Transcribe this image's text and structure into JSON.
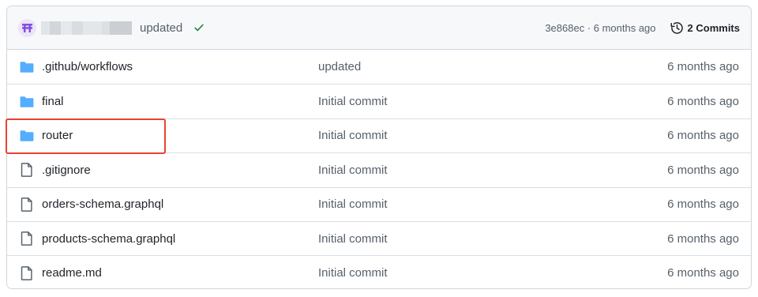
{
  "latest_commit": {
    "message": "updated",
    "sha_info": "3e868ec · 6 months ago",
    "commits_label": "2 Commits"
  },
  "files": [
    {
      "name": ".github/workflows",
      "type": "folder",
      "message": "updated",
      "age": "6 months ago"
    },
    {
      "name": "final",
      "type": "folder",
      "message": "Initial commit",
      "age": "6 months ago"
    },
    {
      "name": "router",
      "type": "folder",
      "message": "Initial commit",
      "age": "6 months ago"
    },
    {
      "name": ".gitignore",
      "type": "file",
      "message": "Initial commit",
      "age": "6 months ago"
    },
    {
      "name": "orders-schema.graphql",
      "type": "file",
      "message": "Initial commit",
      "age": "6 months ago"
    },
    {
      "name": "products-schema.graphql",
      "type": "file",
      "message": "Initial commit",
      "age": "6 months ago"
    },
    {
      "name": "readme.md",
      "type": "file",
      "message": "Initial commit",
      "age": "6 months ago"
    }
  ],
  "icons": {
    "folder": "folder-icon",
    "file": "file-icon",
    "check": "check-icon",
    "history": "history-icon",
    "avatar": "avatar"
  },
  "colors": {
    "folder": "#54aeff",
    "check": "#1a7f37",
    "highlight": "#e8432f",
    "avatar": "#8250df"
  }
}
